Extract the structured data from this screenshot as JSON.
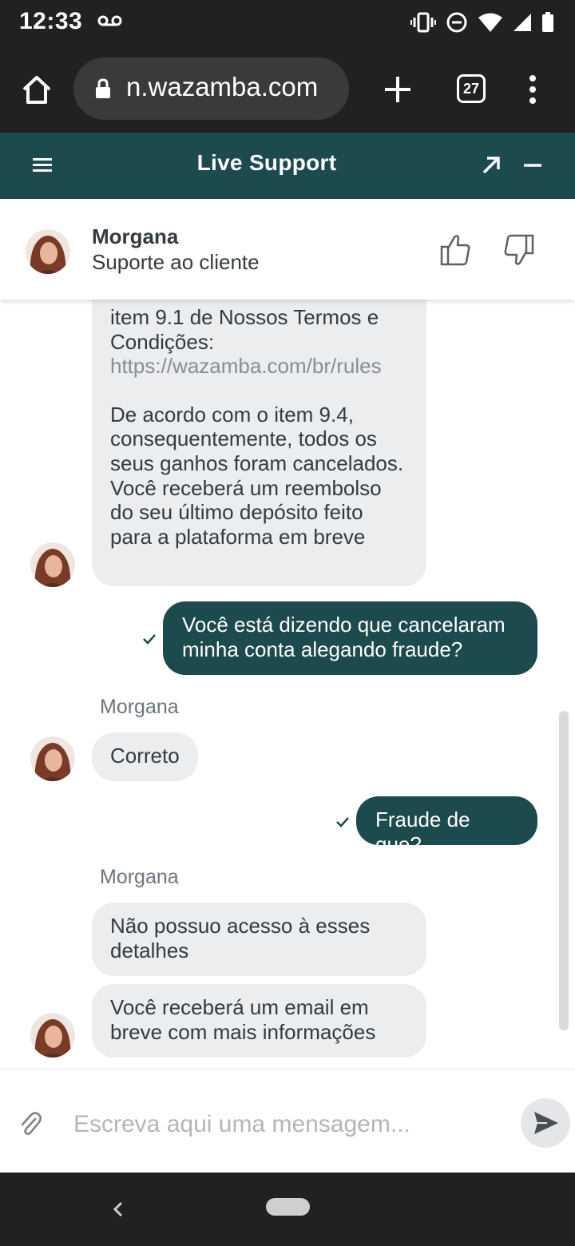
{
  "status_bar": {
    "time": "12:33",
    "icons": [
      "voicemail-icon",
      "vibrate-icon",
      "do-not-disturb-icon",
      "wifi-icon",
      "signal-icon",
      "battery-icon"
    ]
  },
  "browser": {
    "url": "n.wazamba.com",
    "tab_count": "27",
    "icons": [
      "home-icon",
      "lock-icon",
      "plus-icon",
      "more-vert-icon"
    ]
  },
  "chat_header": {
    "title": "Live Support",
    "icons": [
      "menu-icon",
      "expand-arrow-icon",
      "minimize-icon"
    ],
    "color": "#1d4a4d"
  },
  "agent": {
    "name": "Morgana",
    "role": "Suporte ao cliente",
    "icons": [
      "thumbs-up-icon",
      "thumbs-down-icon"
    ]
  },
  "messages": [
    {
      "from": "agent",
      "lines": [
        "item 9.1 de Nossos Termos e Condições:"
      ],
      "link": "https://wazamba.com/br/rules",
      "paragraph": "De acordo com o item 9.4, consequentemente, todos os seus ganhos foram cancelados. Você receberá um reembolso do seu último depósito feito para a plataforma em breve"
    },
    {
      "from": "user",
      "text": "Você está dizendo que cancelaram minha conta alegando fraude?",
      "status": "sent"
    },
    {
      "from": "agent",
      "sender": "Morgana",
      "text": "Correto"
    },
    {
      "from": "user",
      "text": "Fraude de que?",
      "status": "sent"
    },
    {
      "from": "agent",
      "sender": "Morgana",
      "text": "Não possuo acesso à esses detalhes"
    },
    {
      "from": "agent",
      "text": "Você receberá um email em breve com mais informações"
    }
  ],
  "composer": {
    "placeholder": "Escreva aqui uma mensagem...",
    "icons": [
      "paperclip-icon",
      "send-icon"
    ]
  },
  "colors": {
    "accent": "#1d4a4d",
    "incoming_bubble": "#ebedef",
    "system_bar": "#212121"
  }
}
